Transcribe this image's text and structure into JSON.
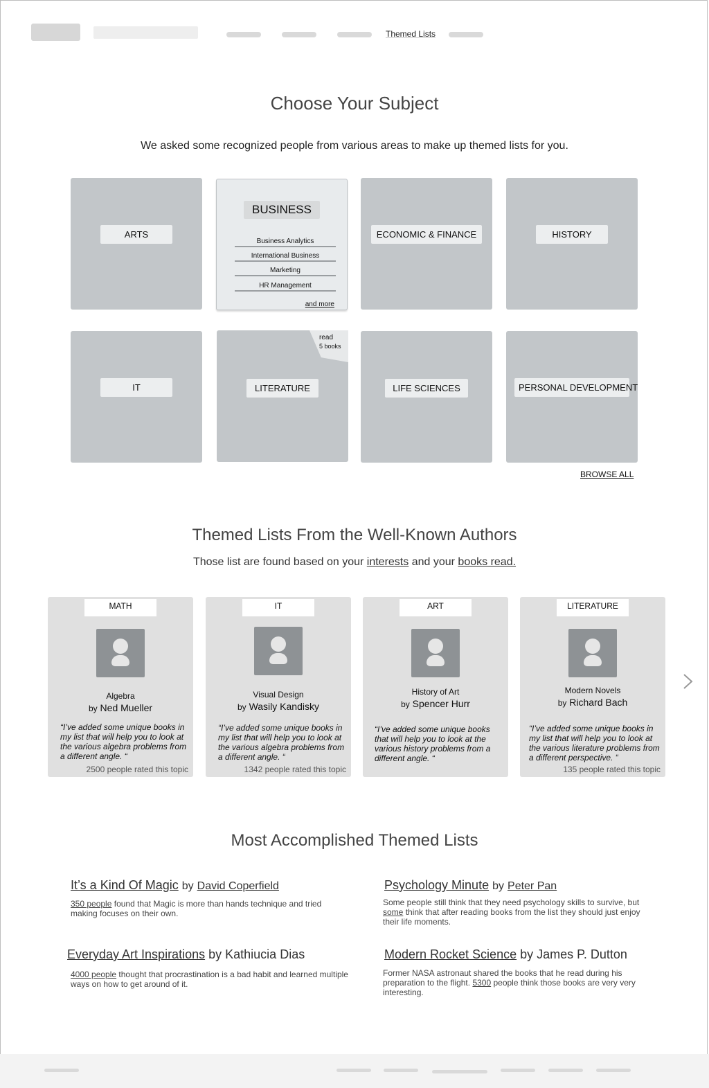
{
  "header": {
    "nav_active": "Themed Lists"
  },
  "subjects": {
    "title": "Choose Your Subject",
    "subtitle": "We asked some recognized people from various areas to make up themed lists for you.",
    "tiles": [
      "ARTS",
      "BUSINESS",
      "ECONOMIC & FINANCE",
      "HISTORY",
      "IT",
      "LITERATURE",
      "LIFE SCIENCES",
      "PERSONAL DEVELOPMENT"
    ],
    "business_items": [
      "Business Analytics",
      "International Business",
      "Marketing",
      "HR Management"
    ],
    "business_more": "and more",
    "literature_badge_line1": "read",
    "literature_badge_line2": "5 books",
    "browse_all": "BROWSE ALL"
  },
  "authors": {
    "title": "Themed Lists From the Well-Known Authors",
    "subtitle_prefix": "Those list are found based on your",
    "subtitle_link1": "interests",
    "subtitle_mid": "and your",
    "subtitle_link2": "books read.",
    "by": "by",
    "cards": [
      {
        "tag": "MATH",
        "topic": "Algebra",
        "author": "Ned Mueller",
        "quote": "“I’ve added some unique books in my list that will help you to look at the various algebra problems from a different angle. “",
        "rated": "2500 people rated this topic"
      },
      {
        "tag": "IT",
        "topic": "Visual Design",
        "author": "Wasily Kandisky",
        "quote": "“I’ve added some unique books in my list that will help you to look at the various algebra problems from a different angle. “",
        "rated": "1342 people rated this topic"
      },
      {
        "tag": "ART",
        "topic": "History of Art",
        "author": "Spencer Hurr",
        "quote": "“I’ve added some unique books that will help you to look at the various history problems from a different angle. “",
        "rated": ""
      },
      {
        "tag": "LITERATURE",
        "topic": "Modern Novels",
        "author": "Richard Bach",
        "quote": "“I’ve added some unique books in my list that will help you to look at the various literature problems from a different perspective. “",
        "rated": "135 people rated this topic"
      }
    ]
  },
  "accomplished": {
    "title": "Most Accomplished Themed Lists",
    "by": "by",
    "items": [
      {
        "list": "It’s a Kind Of Magic",
        "author": "David Coperfield",
        "count": "350 people",
        "desc_rest": "found that Magic is more than hands technique and tried making focuses on their own."
      },
      {
        "list": "Psychology Minute",
        "author": "Peter Pan",
        "desc_a": "Some people still think that they need psychology skills to survive, but",
        "desc_link": "some",
        "desc_b": "think that after reading books from the list they should just enjoy their life moments."
      },
      {
        "list": "Everyday Art Inspirations",
        "author": "Kathiucia Dias",
        "count": "4000 people",
        "desc_rest": "thought that procrastination is a bad habit and learned multiple ways on how to get around of it."
      },
      {
        "list": "Modern Rocket Science",
        "author": "James P. Dutton",
        "desc_a": "Former NASA astronaut shared the books that he read during his preparation to the flight.",
        "desc_link": "5300",
        "desc_b": "people think those books are very very interesting."
      }
    ]
  }
}
